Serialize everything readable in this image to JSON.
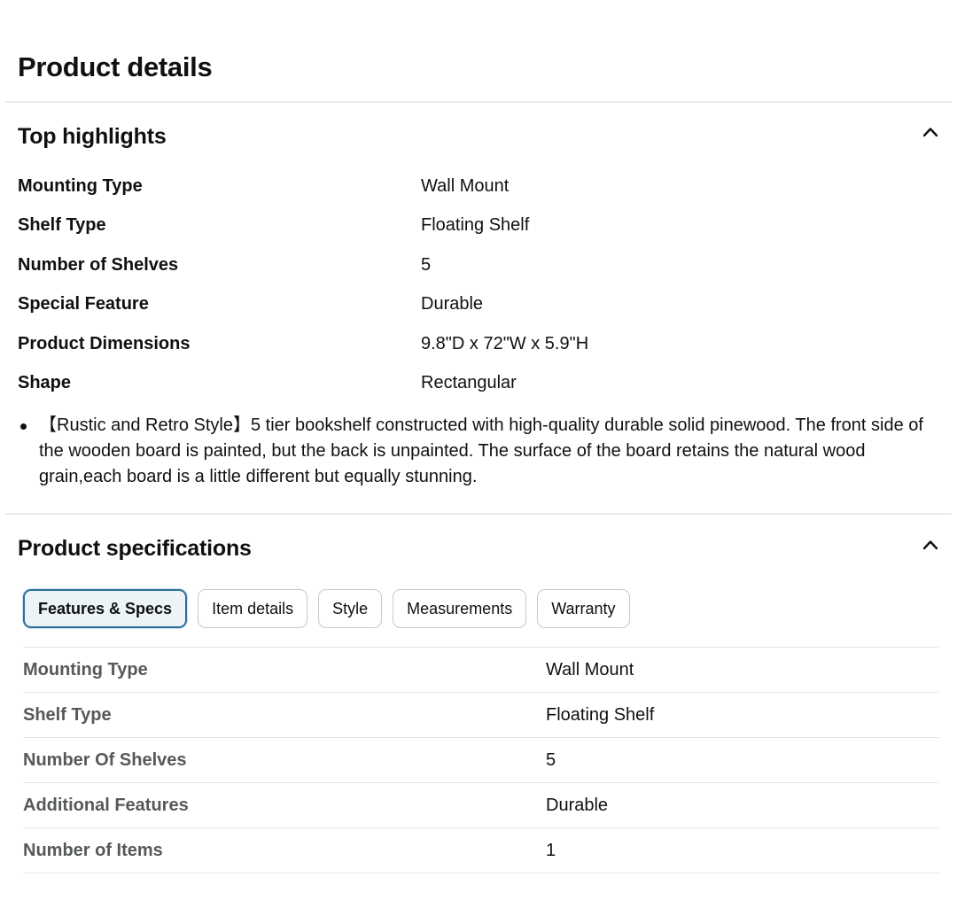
{
  "page_title": "Product details",
  "top_highlights": {
    "heading": "Top highlights",
    "rows": [
      {
        "label": "Mounting Type",
        "value": "Wall Mount"
      },
      {
        "label": "Shelf Type",
        "value": "Floating Shelf"
      },
      {
        "label": "Number of Shelves",
        "value": "5"
      },
      {
        "label": "Special Feature",
        "value": "Durable"
      },
      {
        "label": "Product Dimensions",
        "value": "9.8\"D x 72\"W x 5.9\"H"
      },
      {
        "label": "Shape",
        "value": "Rectangular"
      }
    ],
    "bullets": [
      "【Rustic and Retro Style】5 tier bookshelf constructed with high-quality durable solid pinewood. The front side of the wooden board is painted, but the back is unpainted. The surface of the board retains the natural wood grain,each board is a little different but equally stunning."
    ],
    "collapse_icon": "chevron-up-icon"
  },
  "product_specifications": {
    "heading": "Product specifications",
    "collapse_icon": "chevron-up-icon",
    "tabs": [
      {
        "label": "Features & Specs",
        "active": true
      },
      {
        "label": "Item details",
        "active": false
      },
      {
        "label": "Style",
        "active": false
      },
      {
        "label": "Measurements",
        "active": false
      },
      {
        "label": "Warranty",
        "active": false
      }
    ],
    "rows": [
      {
        "label": "Mounting Type",
        "value": "Wall Mount"
      },
      {
        "label": "Shelf Type",
        "value": "Floating Shelf"
      },
      {
        "label": "Number Of Shelves",
        "value": "5"
      },
      {
        "label": "Additional Features",
        "value": "Durable"
      },
      {
        "label": "Number of Items",
        "value": "1"
      }
    ]
  },
  "colors": {
    "text_primary": "#0f1111",
    "text_secondary": "#565959",
    "active_tab_border": "#2e6f98",
    "active_tab_bg": "#edf4f8",
    "divider": "#eaeded"
  }
}
